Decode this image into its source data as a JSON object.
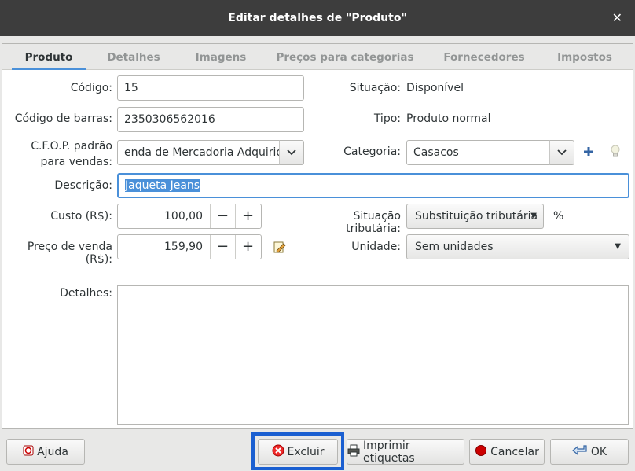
{
  "window": {
    "title": "Editar detalhes de \"Produto\""
  },
  "tabs": [
    {
      "label": "Produto"
    },
    {
      "label": "Detalhes"
    },
    {
      "label": "Imagens"
    },
    {
      "label": "Preços para categorias"
    },
    {
      "label": "Fornecedores"
    },
    {
      "label": "Impostos"
    }
  ],
  "form": {
    "codigo_label": "Código:",
    "codigo_value": "15",
    "barras_label": "Código de barras:",
    "barras_value": "2350306562016",
    "cfop_label_1": "C.F.O.P. padrão",
    "cfop_label_2": "para vendas:",
    "cfop_value": "enda de Mercadoria Adquirida",
    "descricao_label": "Descrição:",
    "descricao_value": "Jaqueta Jeans",
    "custo_label": "Custo (R$):",
    "custo_value": "100,00",
    "preco_label": "Preço de venda (R$):",
    "preco_value": "159,90",
    "detalhes_label": "Detalhes:",
    "situacao_label": "Situação:",
    "situacao_value": "Disponível",
    "tipo_label": "Tipo:",
    "tipo_value": "Produto normal",
    "categoria_label": "Categoria:",
    "categoria_value": "Casacos",
    "trib_label": "Situação tributária:",
    "trib_value": "Substituição tributária",
    "percent": "%",
    "unidade_label": "Unidade:",
    "unidade_value": "Sem unidades",
    "minus": "−",
    "plus": "+"
  },
  "footer": {
    "help": "Ajuda",
    "delete": "Excluir",
    "print": "Imprimir etiquetas",
    "cancel": "Cancelar",
    "ok": "OK"
  },
  "colors": {
    "accent": "#4a90d9",
    "highlight": "#1a5fd1",
    "titlebar": "#3d3d3d"
  }
}
